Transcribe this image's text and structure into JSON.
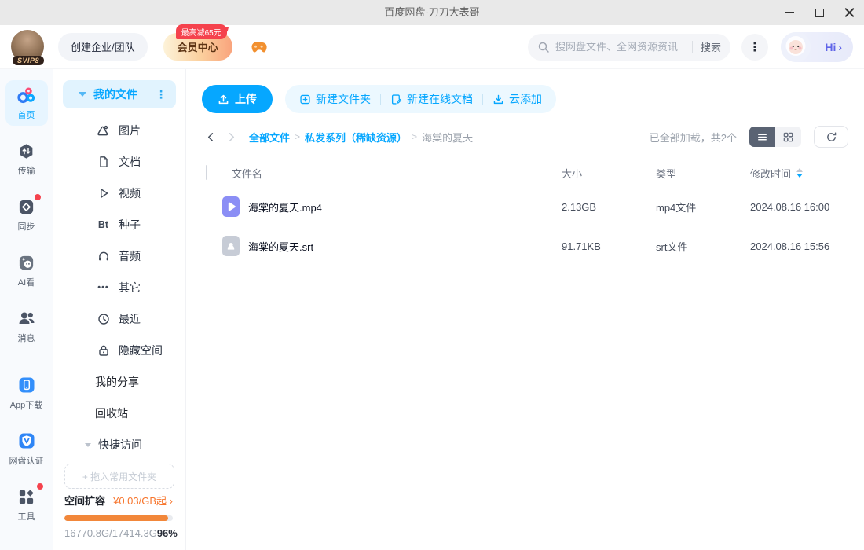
{
  "colors": {
    "primary": "#06a7ff",
    "orange": "#f7752c",
    "red": "#f5424d",
    "progress": "#f2873a"
  },
  "icons": {
    "more_vertical": "⋮",
    "chevron_right": "›"
  },
  "titlebar": {
    "title": "百度网盘·刀刀大表哥"
  },
  "header": {
    "avatar_badge": "SVIP8",
    "create_team_label": "创建企业/团队",
    "vip_center_label": "会员中心",
    "vip_badge": "最高减65元",
    "search_placeholder": "搜网盘文件、全网资源资讯",
    "search_button": "搜索",
    "greeting": "Hi"
  },
  "rail": {
    "home": "首页",
    "transfer": "传输",
    "sync": "同步",
    "ai": "AI看",
    "message": "消息",
    "app_download": "App下载",
    "verify": "网盘认证",
    "tools": "工具"
  },
  "sidenav": {
    "my_files": "我的文件",
    "cat_pictures": "图片",
    "cat_docs": "文档",
    "cat_videos": "视频",
    "cat_seeds": "种子",
    "cat_audio": "音频",
    "cat_other": "其它",
    "cat_recent": "最近",
    "cat_hidden": "隐藏空间",
    "bt_glyph": "Bt",
    "dots_glyph": "•••",
    "my_share": "我的分享",
    "recycle": "回收站",
    "quick_access": "快捷访问",
    "drop_hint": "+ 拖入常用文件夹",
    "expand_label": "空间扩容",
    "expand_price": "¥0.03/GB起",
    "usage_text": "16770.8G/17414.3G",
    "usage_percent": "96%",
    "usage_ratio": 96
  },
  "toolbar": {
    "upload": "上传",
    "new_folder": "新建文件夹",
    "new_doc": "新建在线文档",
    "cloud_add": "云添加"
  },
  "breadcrumb": {
    "root": "全部文件",
    "parent": "私发系列（稀缺资源）",
    "current": "海棠的夏天",
    "sep": ">"
  },
  "listbar": {
    "status": "已全部加载，共2个"
  },
  "table": {
    "col_name": "文件名",
    "col_size": "大小",
    "col_type": "类型",
    "col_time": "修改时间",
    "rows": [
      {
        "name": "海棠的夏天.mp4",
        "size": "2.13GB",
        "type": "mp4文件",
        "time": "2024.08.16 16:00"
      },
      {
        "name": "海棠的夏天.srt",
        "size": "91.71KB",
        "type": "srt文件",
        "time": "2024.08.16 15:56"
      }
    ]
  }
}
